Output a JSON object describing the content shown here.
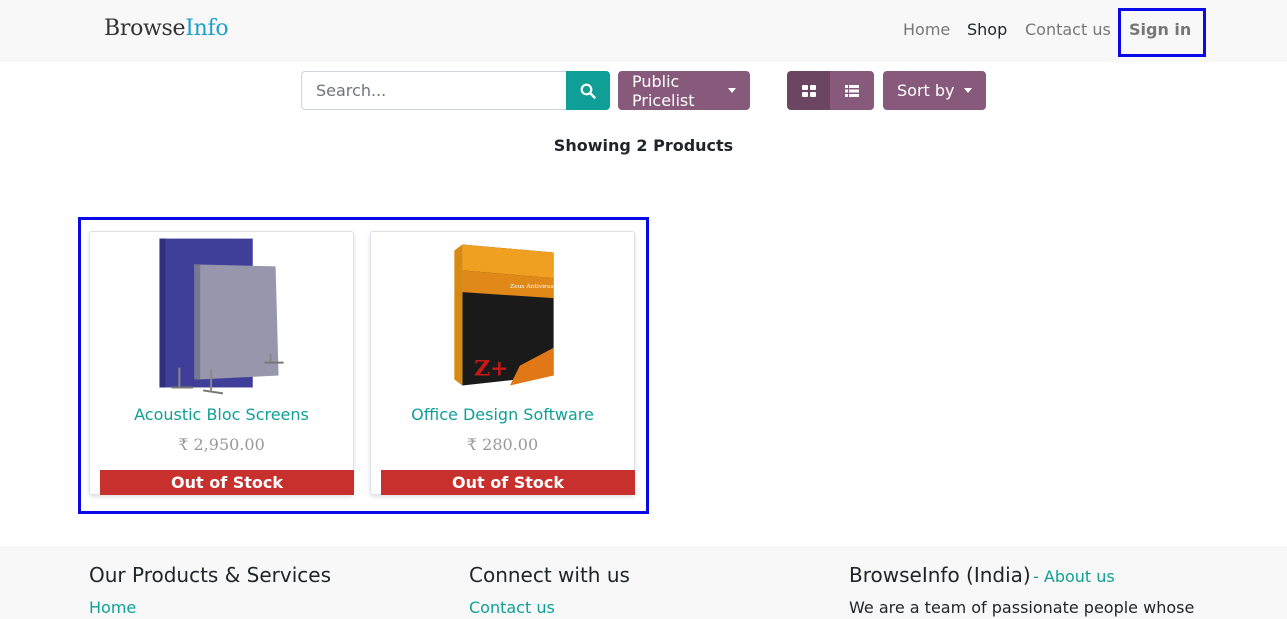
{
  "header": {
    "brand_part1": "Browse",
    "brand_part2": "Info",
    "nav": [
      "Home",
      "Shop",
      "Contact us"
    ],
    "signin": "Sign in"
  },
  "toolbar": {
    "search_placeholder": "Search...",
    "pricelist_label": "Public Pricelist",
    "sort_label": "Sort by"
  },
  "showing": "Showing 2 Products",
  "products": [
    {
      "name": "Acoustic Bloc Screens",
      "price": "₹ 2,950.00",
      "stock": "Out of Stock"
    },
    {
      "name": "Office Design Software",
      "price": "₹ 280.00",
      "stock": "Out of Stock"
    }
  ],
  "footer": {
    "col1_title": "Our Products & Services",
    "col1_link": "Home",
    "col2_title": "Connect with us",
    "col2_link": "Contact us",
    "col3_title": "BrowseInfo (India)",
    "col3_about_sep": "-",
    "col3_about": "About us",
    "col3_text": "We are a team of passionate people whose"
  },
  "colors": {
    "accent": "#0f9f97",
    "primary": "#875a7b",
    "out_of_stock": "#c7302c",
    "highlight": "#0a0ae8"
  }
}
